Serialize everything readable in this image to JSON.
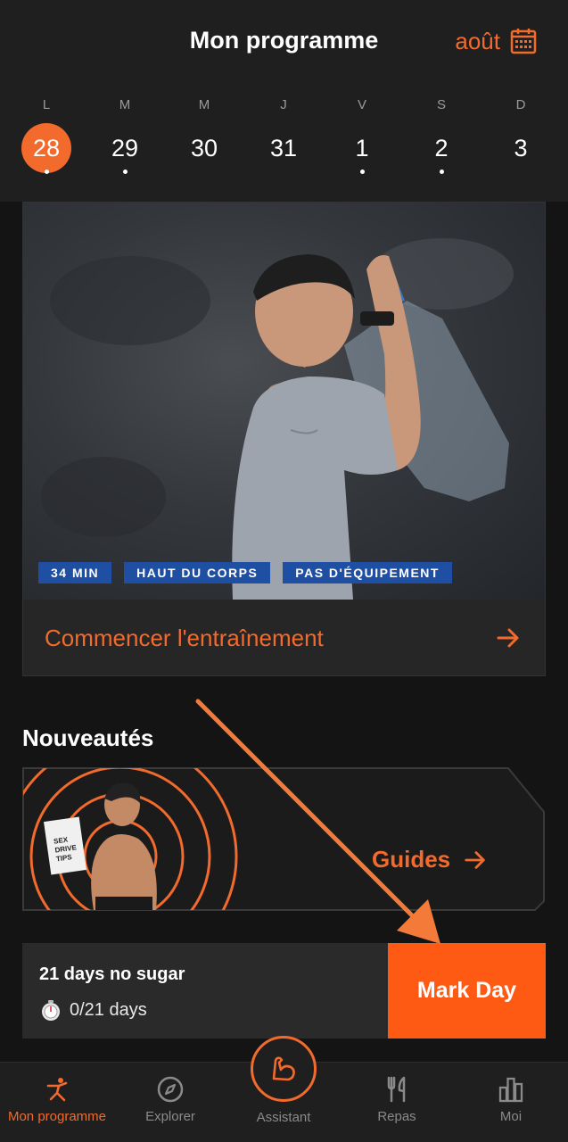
{
  "header": {
    "title": "Mon programme",
    "month": "août",
    "calendar_icon": "calendar-icon"
  },
  "week": [
    {
      "letter": "L",
      "num": "28",
      "selected": true,
      "dot": true
    },
    {
      "letter": "M",
      "num": "29",
      "selected": false,
      "dot": true
    },
    {
      "letter": "M",
      "num": "30",
      "selected": false,
      "dot": false
    },
    {
      "letter": "J",
      "num": "31",
      "selected": false,
      "dot": false
    },
    {
      "letter": "V",
      "num": "1",
      "selected": false,
      "dot": true
    },
    {
      "letter": "S",
      "num": "2",
      "selected": false,
      "dot": true
    },
    {
      "letter": "D",
      "num": "3",
      "selected": false,
      "dot": false
    }
  ],
  "workout": {
    "tags": [
      "34 MIN",
      "HAUT DU CORPS",
      "PAS D'ÉQUIPEMENT"
    ],
    "start_label": "Commencer l'entraînement"
  },
  "news": {
    "title": "Nouveautés",
    "guides_label": "Guides",
    "book_text": "SEX DRIVE TIPS"
  },
  "challenge": {
    "title": "21 days no sugar",
    "progress": "0/21 days",
    "button": "Mark Day"
  },
  "tabs": {
    "program": "Mon programme",
    "explore": "Explorer",
    "assistant": "Assistant",
    "meals": "Repas",
    "me": "Moi"
  },
  "colors": {
    "accent": "#f26a2c",
    "mark_button": "#ff5a14",
    "tag_blue": "#1f4fa3",
    "background": "#141414"
  }
}
